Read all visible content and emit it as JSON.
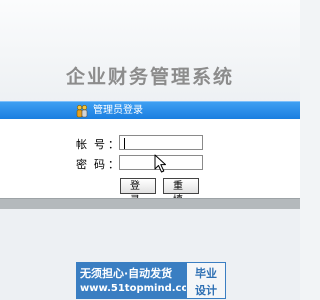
{
  "app": {
    "title": "企业财务管理系统"
  },
  "login": {
    "header_label": "管理员登录",
    "header_icon": "users-icon",
    "account_label": "帐号",
    "password_label": "密码",
    "colon": "：",
    "account_value": "",
    "password_value": "",
    "login_button": "登录",
    "reset_button": "重填"
  },
  "watermark": {
    "line1": "无须担心·自动发货",
    "line2": "www.51topmind.com",
    "tag1": "毕业",
    "tag2": "设计"
  },
  "colors": {
    "header_bar": "#1a7ee0",
    "title_text": "#8c8c8c",
    "watermark_blue": "#3a7ec2"
  }
}
